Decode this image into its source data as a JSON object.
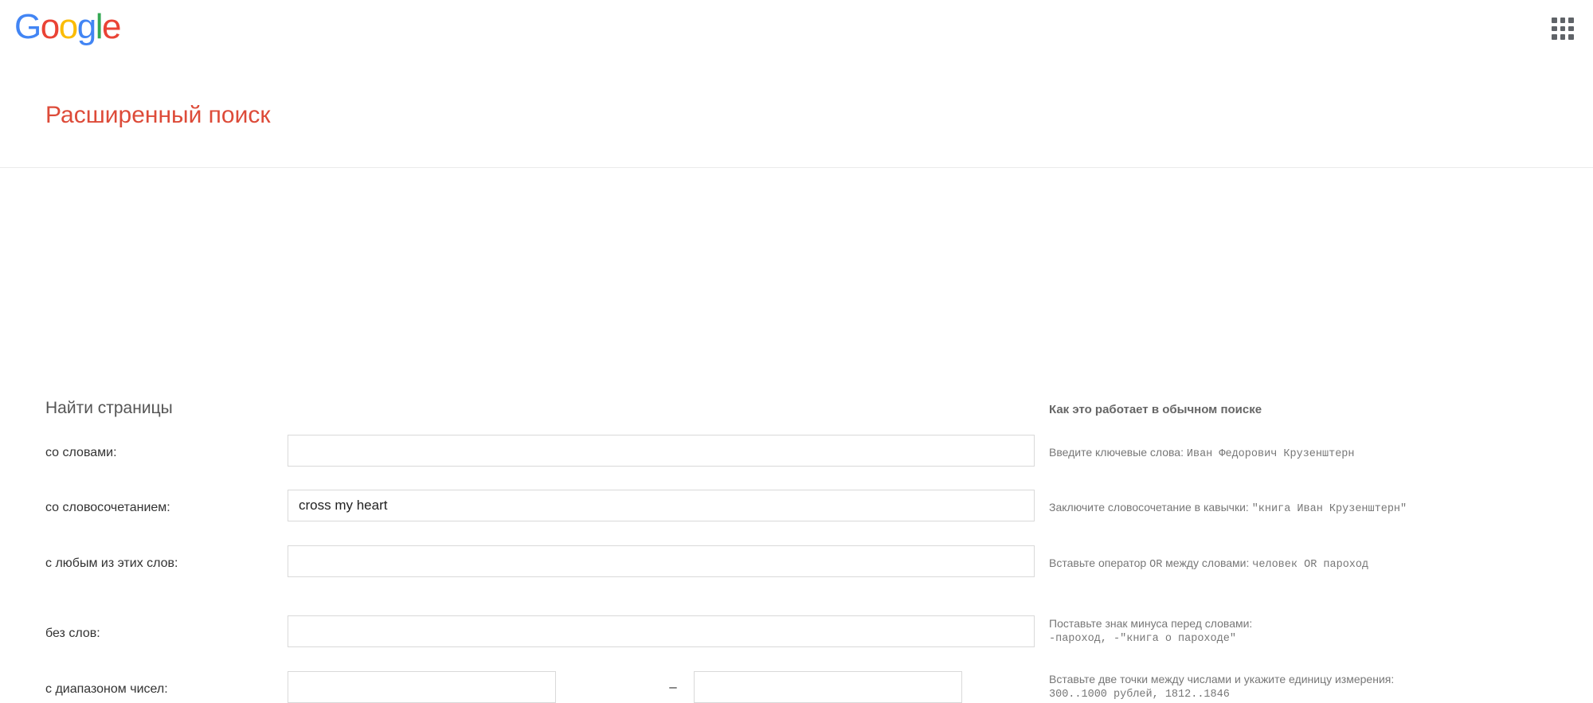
{
  "brand": {
    "logo_text": "Google",
    "logo_letters": [
      {
        "char": "G",
        "color": "#4285f4"
      },
      {
        "char": "o",
        "color": "#ea4335"
      },
      {
        "char": "o",
        "color": "#fbbc05"
      },
      {
        "char": "g",
        "color": "#4285f4"
      },
      {
        "char": "l",
        "color": "#34a853"
      },
      {
        "char": "e",
        "color": "#ea4335"
      }
    ]
  },
  "header": {
    "title": "Расширенный поиск",
    "title_color": "#dd4b39",
    "apps_icon": "apps-grid-icon"
  },
  "form": {
    "section_heading": "Найти страницы",
    "help_heading": "Как это работает в обычном поиске",
    "range_separator": "–",
    "rows": [
      {
        "label": "со словами:",
        "value": "",
        "placeholder": "",
        "help_prefix": "Введите ключевые слова: ",
        "help_example": "Иван  Федорович  Крузенштерн",
        "help_line2": ""
      },
      {
        "label": "со словосочетанием:",
        "value": "cross my heart",
        "placeholder": "",
        "help_prefix": "Заключите словосочетание в кавычки: ",
        "help_example": "\"книга  Иван  Крузенштерн\"",
        "help_line2": ""
      },
      {
        "label": "с любым из этих слов:",
        "value": "",
        "placeholder": "",
        "help_prefix": "Вставьте оператор ",
        "help_example": "OR",
        "help_suffix": " между словами: ",
        "help_example2": "человек  OR  пароход",
        "help_line2": ""
      },
      {
        "label": "без слов:",
        "value": "",
        "placeholder": "",
        "help_prefix": "Поставьте знак минуса перед словами:",
        "help_example": "",
        "help_line2": "-пароход,  -\"книга  о  пароходе\""
      },
      {
        "label": "с диапазоном чисел:",
        "value_from": "",
        "value_to": "",
        "placeholder": "",
        "help_prefix": "Вставьте две точки между числами и укажите единицу измерения:",
        "help_example": "",
        "help_line2": "300..1000  рублей,  1812..1846"
      }
    ]
  }
}
